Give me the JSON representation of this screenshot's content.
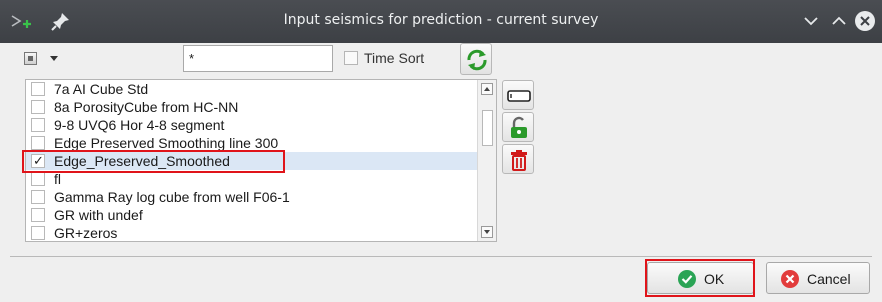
{
  "window": {
    "title": "Input seismics for prediction - current survey"
  },
  "toolbar": {
    "filter_value": "*",
    "time_sort_label": "Time Sort",
    "time_sort_checked": false
  },
  "list": {
    "items": [
      {
        "label": "7a AI Cube Std",
        "checked": false
      },
      {
        "label": "8a PorosityCube from HC-NN",
        "checked": false
      },
      {
        "label": "9-8 UVQ6 Hor 4-8 segment",
        "checked": false
      },
      {
        "label": "Edge Preserved Smoothing line 300",
        "checked": false
      },
      {
        "label": "Edge_Preserved_Smoothed",
        "checked": true
      },
      {
        "label": "fl",
        "checked": false
      },
      {
        "label": "Gamma Ray log cube from well F06-1",
        "checked": false
      },
      {
        "label": "GR with undef",
        "checked": false
      },
      {
        "label": "GR+zeros",
        "checked": false
      }
    ]
  },
  "footer": {
    "ok_label": "OK",
    "cancel_label": "Cancel"
  },
  "colors": {
    "titlebar": "#3d4045",
    "highlight": "#e0141a",
    "ok_icon": "#2aa455",
    "cancel_icon": "#e23b3b",
    "refresh": "#2b9a2b"
  }
}
